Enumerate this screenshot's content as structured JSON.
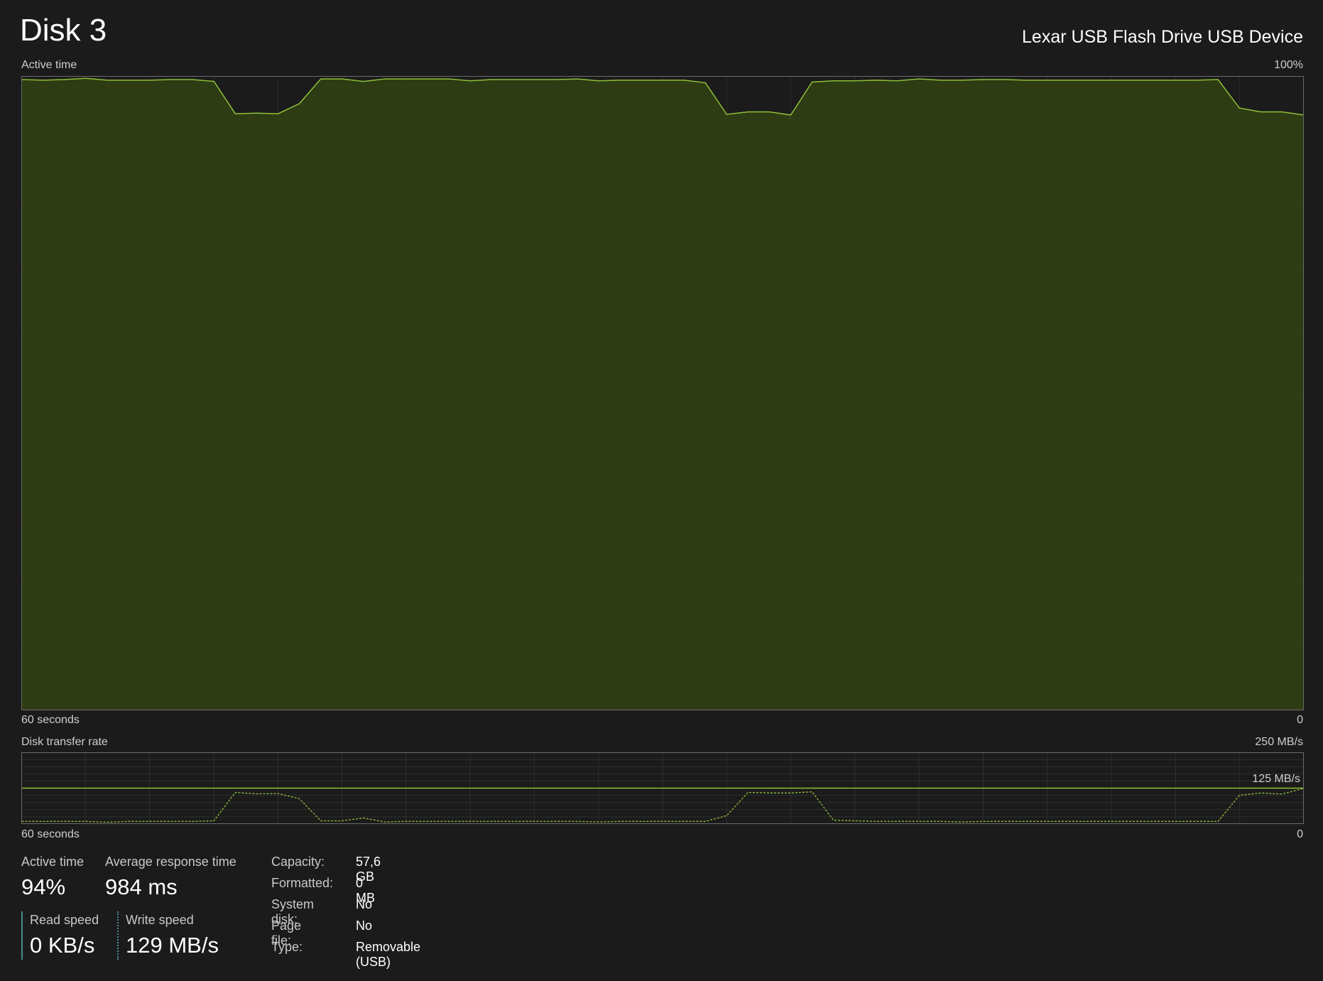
{
  "header": {
    "title": "Disk 3",
    "device": "Lexar USB Flash Drive USB Device"
  },
  "active_chart": {
    "label": "Active time",
    "max_label": "100%",
    "time_label": "60 seconds",
    "zero_label": "0"
  },
  "transfer_chart": {
    "label": "Disk transfer rate",
    "max_label": "250 MB/s",
    "mid_label": "125 MB/s",
    "time_label": "60 seconds",
    "zero_label": "0"
  },
  "stats": {
    "active_time": {
      "label": "Active time",
      "value": "94%"
    },
    "avg_response": {
      "label": "Average response time",
      "value": "984 ms"
    },
    "read_speed": {
      "label": "Read speed",
      "value": "0 KB/s"
    },
    "write_speed": {
      "label": "Write speed",
      "value": "129 MB/s"
    }
  },
  "properties": [
    {
      "label": "Capacity:",
      "value": "57,6 GB"
    },
    {
      "label": "Formatted:",
      "value": "0 MB"
    },
    {
      "label": "System disk:",
      "value": "No"
    },
    {
      "label": "Page file:",
      "value": "No"
    },
    {
      "label": "Type:",
      "value": "Removable (USB)"
    }
  ],
  "colors": {
    "background": "#1b1b1b",
    "chart_fill": "#2d3c12",
    "chart_line": "#8fbf3a",
    "grid": "#3a4428",
    "accent_bar": "#4a8a8c"
  },
  "chart_data": [
    {
      "type": "area",
      "title": "Active time",
      "ylim": [
        0,
        100
      ],
      "x_label": "60 seconds",
      "x": [
        0,
        1,
        2,
        3,
        4,
        5,
        6,
        7,
        8,
        9,
        10,
        11,
        12,
        13,
        14,
        15,
        16,
        17,
        18,
        19,
        20,
        21,
        22,
        23,
        24,
        25,
        26,
        27,
        28,
        29,
        30,
        31,
        32,
        33,
        34,
        35,
        36,
        37,
        38,
        39,
        40,
        41,
        42,
        43,
        44,
        45,
        46,
        47,
        48,
        49,
        50,
        51,
        52,
        53,
        54,
        55,
        56,
        57,
        58,
        59
      ],
      "series": [
        {
          "values": [
            99.5,
            99.4,
            99.5,
            99.7,
            99.4,
            99.4,
            99.4,
            99.5,
            99.5,
            99.2,
            94.1,
            94.2,
            94.1,
            95.7,
            99.6,
            99.6,
            99.2,
            99.6,
            99.6,
            99.6,
            99.6,
            99.3,
            99.5,
            99.5,
            99.5,
            99.5,
            99.6,
            99.3,
            99.4,
            99.4,
            99.4,
            99.4,
            99.0,
            94.0,
            94.4,
            94.4,
            93.9,
            99.1,
            99.3,
            99.3,
            99.4,
            99.3,
            99.6,
            99.4,
            99.4,
            99.5,
            99.5,
            99.4,
            99.4,
            99.4,
            99.4,
            99.4,
            99.4,
            99.4,
            99.4,
            99.4,
            99.5,
            95.0,
            94.4,
            94.4,
            93.9
          ]
        }
      ],
      "grid": true
    },
    {
      "type": "line",
      "title": "Disk transfer rate",
      "ylim": [
        0,
        250
      ],
      "x_label": "60 seconds",
      "reference_line": 125,
      "x": [
        0,
        1,
        2,
        3,
        4,
        5,
        6,
        7,
        8,
        9,
        10,
        11,
        12,
        13,
        14,
        15,
        16,
        17,
        18,
        19,
        20,
        21,
        22,
        23,
        24,
        25,
        26,
        27,
        28,
        29,
        30,
        31,
        32,
        33,
        34,
        35,
        36,
        37,
        38,
        39,
        40,
        41,
        42,
        43,
        44,
        45,
        46,
        47,
        48,
        49,
        50,
        51,
        52,
        53,
        54,
        55,
        56,
        57,
        58,
        59
      ],
      "series": [
        {
          "values": [
            8,
            8,
            8,
            8,
            5,
            8,
            8,
            8,
            8,
            10,
            110,
            105,
            106,
            88,
            10,
            10,
            20,
            6,
            8,
            8,
            8,
            8,
            8,
            8,
            8,
            8,
            8,
            6,
            8,
            8,
            8,
            8,
            8,
            28,
            110,
            108,
            108,
            112,
            12,
            10,
            8,
            8,
            8,
            8,
            6,
            8,
            8,
            8,
            8,
            8,
            8,
            8,
            8,
            8,
            8,
            8,
            8,
            100,
            108,
            104,
            124
          ]
        }
      ],
      "grid": true
    }
  ]
}
